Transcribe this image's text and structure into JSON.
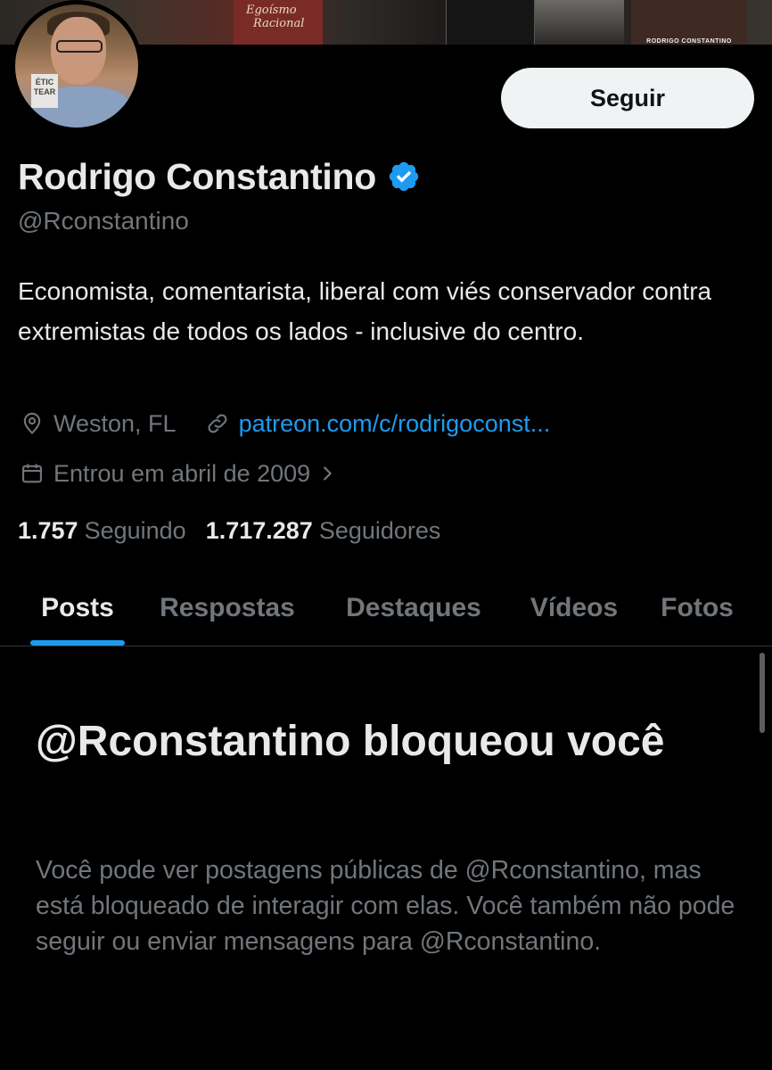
{
  "banner": {
    "book_title_1": "Egoísmo",
    "book_title_2": "Racional",
    "author_spine": "RODRIGO CONSTANTINO"
  },
  "avatar": {
    "mug_text": "ÉTIC TEAR"
  },
  "profile": {
    "display_name": "Rodrigo Constantino",
    "handle": "@Rconstantino",
    "bio": "Economista, comentarista, liberal com viés conservador contra extremistas de todos os lados - inclusive do centro.",
    "location": "Weston, FL",
    "link": "patreon.com/c/rodrigoconst...",
    "joined": "Entrou em abril de 2009",
    "verified_color": "#1d9bf0"
  },
  "actions": {
    "follow_label": "Seguir"
  },
  "stats": {
    "following_count": "1.757",
    "following_label": "Seguindo",
    "followers_count": "1.717.287",
    "followers_label": "Seguidores"
  },
  "tabs": [
    {
      "label": "Posts",
      "active": true
    },
    {
      "label": "Respostas"
    },
    {
      "label": "Destaques"
    },
    {
      "label": "Vídeos"
    },
    {
      "label": "Fotos"
    }
  ],
  "blocked": {
    "title": "@Rconstantino bloqueou você",
    "description": "Você pode ver postagens públicas de @Rconstantino, mas está bloqueado de interagir com elas. Você também não pode seguir ou enviar mensagens para @Rconstantino."
  },
  "colors": {
    "background": "#000000",
    "accent": "#1d9bf0",
    "primary_text": "#e7e9ea",
    "secondary_text": "#71767b"
  }
}
